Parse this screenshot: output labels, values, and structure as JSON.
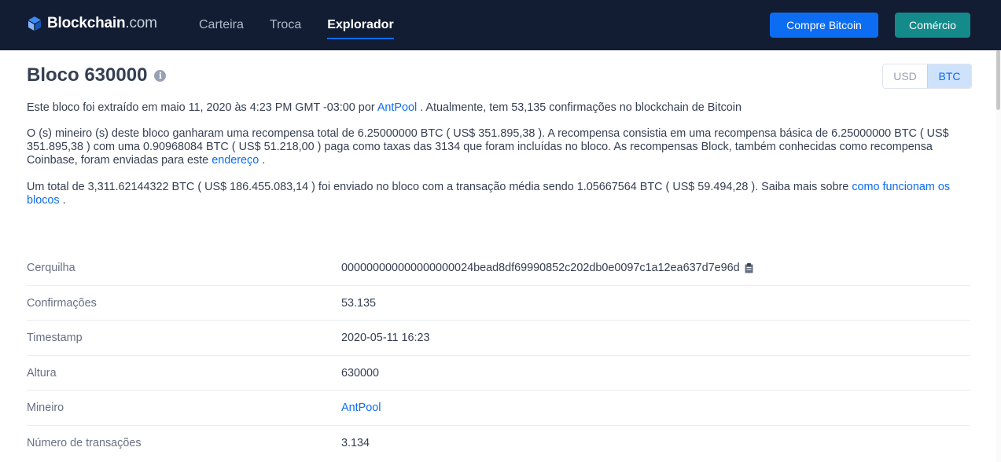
{
  "header": {
    "logo_name": "Blockchain",
    "logo_domain": ".com",
    "nav": [
      {
        "label": "Carteira",
        "active": false
      },
      {
        "label": "Troca",
        "active": false
      },
      {
        "label": "Explorador",
        "active": true
      }
    ],
    "buy_label": "Compre Bitcoin",
    "trade_label": "Comércio",
    "colors": {
      "bg": "#121d33",
      "buy": "#0c6cf2",
      "trade": "#148a8a"
    }
  },
  "page": {
    "title": "Bloco 630000",
    "info_icon": "i",
    "currency": {
      "usd": "USD",
      "btc": "BTC",
      "selected": "BTC"
    }
  },
  "para1": {
    "t1": "Este bloco foi extraído em maio 11, 2020 às 4:23 PM GMT -03:00 por ",
    "link": "AntPool",
    "t2": " . Atualmente, tem 53,135 confirmações no blockchain de Bitcoin"
  },
  "para2": {
    "t1": "O (s) mineiro (s) deste bloco ganharam uma recompensa total de 6.25000000 BTC ( US$ 351.895,38 ). A recompensa consistia em uma recompensa básica de 6.25000000 BTC ( US$ 351.895,38 ) com uma 0.90968084 BTC ( US$ 51.218,00 ) paga como taxas das 3134 que foram incluídas no bloco. As recompensas Block, também conhecidas como recompensa Coinbase, foram enviadas para este ",
    "link": "endereço",
    "t2": " ."
  },
  "para3": {
    "t1": "Um total de 3,311.62144322 BTC ( US$ 186.455.083,14 ) foi enviado no bloco com a transação média sendo 1.05667564 BTC ( US$ 59.494,28 ).  Saiba mais sobre ",
    "link": "como funcionam os blocos",
    "t2": " ."
  },
  "details": [
    {
      "label": "Cerquilha",
      "value": "000000000000000000024bead8df69990852c202db0e0097c1a12ea637d7e96d",
      "copy": true,
      "link": false
    },
    {
      "label": "Confirmações",
      "value": "53.135",
      "copy": false,
      "link": false
    },
    {
      "label": "Timestamp",
      "value": "2020-05-11 16:23",
      "copy": false,
      "link": false
    },
    {
      "label": "Altura",
      "value": "630000",
      "copy": false,
      "link": false
    },
    {
      "label": "Mineiro",
      "value": "AntPool",
      "copy": false,
      "link": true
    },
    {
      "label": "Número de transações",
      "value": "3.134",
      "copy": false,
      "link": false
    }
  ]
}
